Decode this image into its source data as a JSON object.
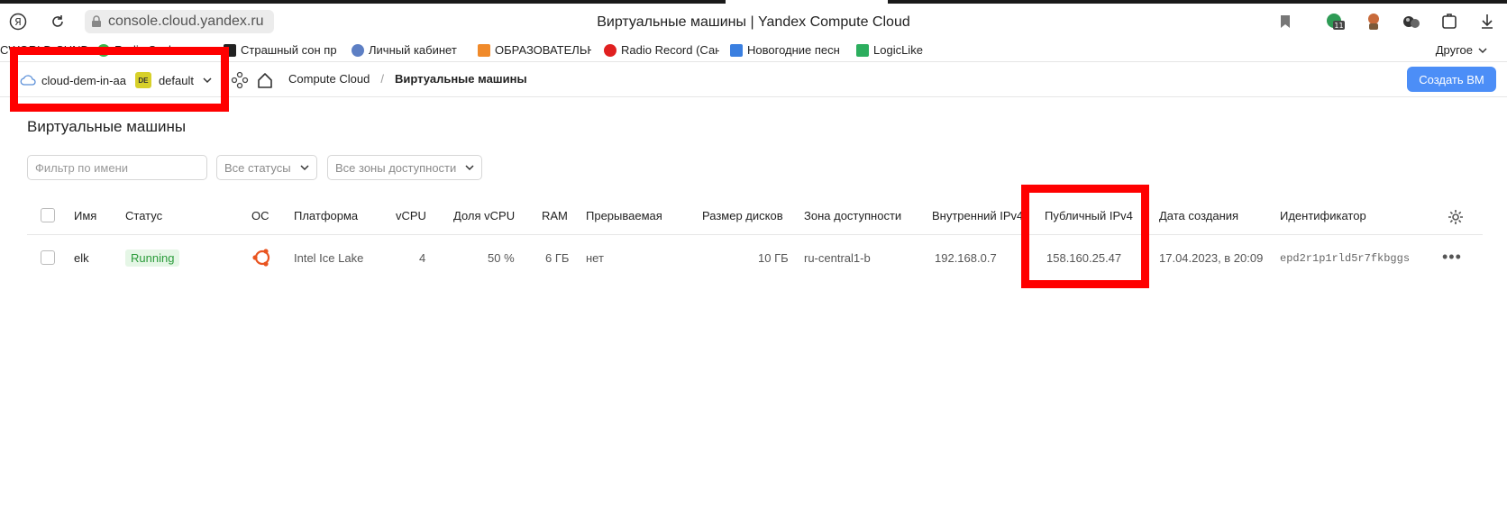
{
  "browser": {
    "url": "console.cloud.yandex.ru",
    "title": "Виртуальные машины | Yandex Compute Cloud"
  },
  "bookmarks": {
    "items": [
      "CWORLD-SHND...",
      "Radio Sovkom ...",
      "Страшный сон пр",
      "Личный кабинет",
      "ОБРАЗОВАТЕЛЬН",
      "Radio Record (Сан",
      "Новогодние песн",
      "LogicLike"
    ],
    "other": "Другое"
  },
  "header": {
    "cloud": "cloud-dem-in-aa",
    "folder_badge": "DE",
    "folder": "default",
    "breadcrumb": [
      "Compute Cloud",
      "/",
      "Виртуальные машины"
    ],
    "create_button": "Создать ВМ"
  },
  "page": {
    "heading": "Виртуальные машины",
    "filter_placeholder": "Фильтр по имени",
    "status_select": "Все статусы",
    "zone_select": "Все зоны доступности"
  },
  "table": {
    "columns": {
      "name": "Имя",
      "status": "Статус",
      "os": "ОС",
      "platform": "Платформа",
      "vcpu": "vCPU",
      "vcpu_share": "Доля vCPU",
      "ram": "RAM",
      "preemptible": "Прерываемая",
      "disk": "Размер дисков",
      "zone": "Зона доступности",
      "internal_ip": "Внутренний IPv4",
      "public_ip": "Публичный IPv4",
      "created": "Дата создания",
      "id": "Идентификатор"
    },
    "rows": [
      {
        "name": "elk",
        "status": "Running",
        "os_icon": "ubuntu-icon",
        "platform": "Intel Ice Lake",
        "vcpu": "4",
        "vcpu_share": "50 %",
        "ram": "6 ГБ",
        "preemptible": "нет",
        "disk": "10 ГБ",
        "zone": "ru-central1-b",
        "internal_ip": "192.168.0.7",
        "public_ip": "158.160.25.47",
        "created": "17.04.2023, в 20:09",
        "id": "epd2r1p1rld5r7fkbggs"
      }
    ]
  },
  "colors": {
    "accent": "#4c8ef7",
    "highlight": "#ff0000",
    "running_bg": "#e5f6e6",
    "running_text": "#2a9b3a"
  }
}
